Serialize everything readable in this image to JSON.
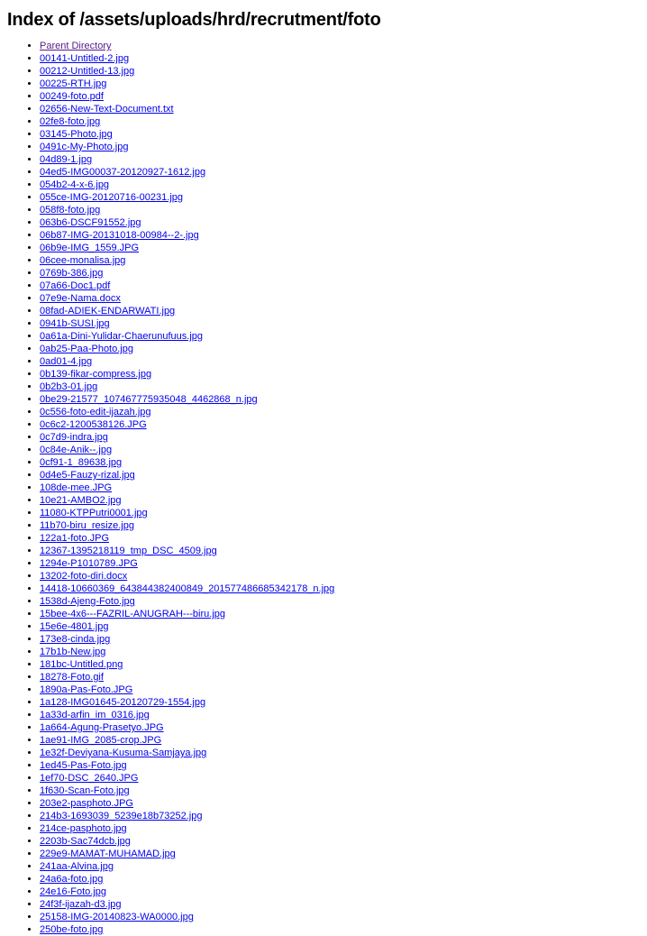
{
  "page": {
    "title": "Index of /assets/uploads/hrd/recrutment/foto",
    "directory_path": "/assets/uploads/hrd/recrutment/foto",
    "link_color": "#0000ee",
    "visited_link_color": "#551a8b",
    "background_color": "#ffffff",
    "text_color": "#000000"
  },
  "listing": {
    "entries": [
      {
        "label": "Parent Directory",
        "visited": true
      },
      {
        "label": "00141-Untitled-2.jpg",
        "visited": false
      },
      {
        "label": "00212-Untitled-13.jpg",
        "visited": false
      },
      {
        "label": "00225-RTH.jpg",
        "visited": false
      },
      {
        "label": "00249-foto.pdf",
        "visited": false
      },
      {
        "label": "02656-New-Text-Document.txt",
        "visited": false
      },
      {
        "label": "02fe8-foto.jpg",
        "visited": false
      },
      {
        "label": "03145-Photo.jpg",
        "visited": false
      },
      {
        "label": "0491c-My-Photo.jpg",
        "visited": false
      },
      {
        "label": "04d89-1.jpg",
        "visited": false
      },
      {
        "label": "04ed5-IMG00037-20120927-1612.jpg",
        "visited": false
      },
      {
        "label": "054b2-4-x-6.jpg",
        "visited": false
      },
      {
        "label": "055ce-IMG-20120716-00231.jpg",
        "visited": false
      },
      {
        "label": "058f8-foto.jpg",
        "visited": false
      },
      {
        "label": "063b6-DSCF91552.jpg",
        "visited": false
      },
      {
        "label": "06b87-IMG-20131018-00984--2-.jpg",
        "visited": false
      },
      {
        "label": "06b9e-IMG_1559.JPG",
        "visited": false
      },
      {
        "label": "06cee-monalisa.jpg",
        "visited": false
      },
      {
        "label": "0769b-386.jpg",
        "visited": false
      },
      {
        "label": "07a66-Doc1.pdf",
        "visited": false
      },
      {
        "label": "07e9e-Nama.docx",
        "visited": false
      },
      {
        "label": "08fad-ADIEK-ENDARWATI.jpg",
        "visited": false
      },
      {
        "label": "0941b-SUSI.jpg",
        "visited": false
      },
      {
        "label": "0a61a-Dini-Yulidar-Chaerunufuus.jpg",
        "visited": false
      },
      {
        "label": "0ab25-Paa-Photo.jpg",
        "visited": false
      },
      {
        "label": "0ad01-4.jpg",
        "visited": false
      },
      {
        "label": "0b139-fikar-compress.jpg",
        "visited": false
      },
      {
        "label": "0b2b3-01.jpg",
        "visited": false
      },
      {
        "label": "0be29-21577_107467775935048_4462868_n.jpg",
        "visited": false
      },
      {
        "label": "0c556-foto-edit-ijazah.jpg",
        "visited": false
      },
      {
        "label": "0c6c2-1200538126.JPG",
        "visited": false
      },
      {
        "label": "0c7d9-indra.jpg",
        "visited": false
      },
      {
        "label": "0c84e-Anik--.jpg",
        "visited": false
      },
      {
        "label": "0cf91-1_89638.jpg",
        "visited": false
      },
      {
        "label": "0d4e5-Fauzy-rizal.jpg",
        "visited": false
      },
      {
        "label": "108de-mee.JPG",
        "visited": false
      },
      {
        "label": "10e21-AMBO2.jpg",
        "visited": false
      },
      {
        "label": "11080-KTPPutri0001.jpg",
        "visited": false
      },
      {
        "label": "11b70-biru_resize.jpg",
        "visited": false
      },
      {
        "label": "122a1-foto.JPG",
        "visited": false
      },
      {
        "label": "12367-1395218119_tmp_DSC_4509.jpg",
        "visited": false
      },
      {
        "label": "1294e-P1010789.JPG",
        "visited": false
      },
      {
        "label": "13202-foto-diri.docx",
        "visited": false
      },
      {
        "label": "14418-10660369_643844382400849_201577486685342178_n.jpg",
        "visited": false
      },
      {
        "label": "1538d-Ajeng-Foto.jpg",
        "visited": false
      },
      {
        "label": "15bee-4x6---FAZRIL-ANUGRAH---biru.jpg",
        "visited": false
      },
      {
        "label": "15e6e-4801.jpg",
        "visited": false
      },
      {
        "label": "173e8-cinda.jpg",
        "visited": false
      },
      {
        "label": "17b1b-New.jpg",
        "visited": false
      },
      {
        "label": "181bc-Untitled.png",
        "visited": false
      },
      {
        "label": "18278-Foto.gif",
        "visited": false
      },
      {
        "label": "1890a-Pas-Foto.JPG",
        "visited": false
      },
      {
        "label": "1a128-IMG01645-20120729-1554.jpg",
        "visited": false
      },
      {
        "label": "1a33d-arfin_im_0316.jpg",
        "visited": false
      },
      {
        "label": "1a664-Agung-Prasetyo.JPG",
        "visited": false
      },
      {
        "label": "1ae91-IMG_2085-crop.JPG",
        "visited": false
      },
      {
        "label": "1e32f-Deviyana-Kusuma-Samjaya.jpg",
        "visited": false
      },
      {
        "label": "1ed45-Pas-Foto.jpg",
        "visited": false
      },
      {
        "label": "1ef70-DSC_2640.JPG",
        "visited": false
      },
      {
        "label": "1f630-Scan-Foto.jpg",
        "visited": false
      },
      {
        "label": "203e2-pasphoto.JPG",
        "visited": false
      },
      {
        "label": "214b3-1693039_5239e18b73252.jpg",
        "visited": false
      },
      {
        "label": "214ce-pasphoto.jpg",
        "visited": false
      },
      {
        "label": "2203b-Sac74dcb.jpg",
        "visited": false
      },
      {
        "label": "229e9-MAMAT-MUHAMAD.jpg",
        "visited": false
      },
      {
        "label": "241aa-Alvina.jpg",
        "visited": false
      },
      {
        "label": "24a6a-foto.jpg",
        "visited": false
      },
      {
        "label": "24e16-Foto.jpg",
        "visited": false
      },
      {
        "label": "24f3f-ijazah-d3.jpg",
        "visited": false
      },
      {
        "label": "25158-IMG-20140823-WA0000.jpg",
        "visited": false
      },
      {
        "label": "250be-foto.jpg",
        "visited": false
      }
    ]
  }
}
